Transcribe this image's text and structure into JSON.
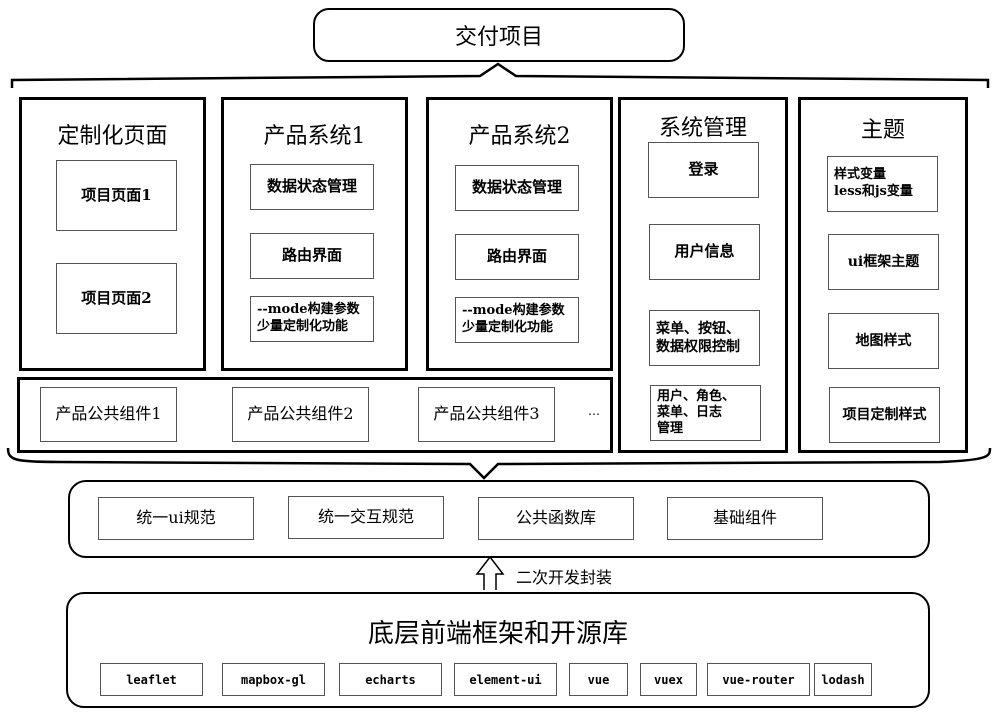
{
  "top": {
    "title": "交付项目"
  },
  "panels": [
    {
      "title": "定制化页面",
      "items": [
        "项目页面1",
        "项目页面2"
      ]
    },
    {
      "title": "产品系统1",
      "items": [
        "数据状态管理",
        "路由界面",
        "--mode构建参数\n少量定制化功能"
      ]
    },
    {
      "title": "产品系统2",
      "items": [
        "数据状态管理",
        "路由界面",
        "--mode构建参数\n少量定制化功能"
      ]
    },
    {
      "title": "系统管理",
      "items": [
        "登录",
        "用户信息",
        "菜单、按钮、\n数据权限控制",
        "用户、角色、\n菜单、日志\n管理"
      ]
    },
    {
      "title": "主题",
      "items": [
        "样式变量\nless和js变量",
        "ui框架主题",
        "地图样式",
        "项目定制样式"
      ]
    }
  ],
  "common_components": {
    "items": [
      "产品公共组件1",
      "产品公共组件2",
      "产品公共组件3"
    ],
    "ellipsis": "…"
  },
  "middle_layer": {
    "items": [
      "统一ui规范",
      "统一交互规范",
      "公共函数库",
      "基础组件"
    ]
  },
  "arrow_label": "二次开发封装",
  "bottom_layer": {
    "title": "底层前端框架和开源库",
    "libs": [
      "leaflet",
      "mapbox-gl",
      "echarts",
      "element-ui",
      "vue",
      "vuex",
      "vue-router",
      "lodash"
    ]
  }
}
